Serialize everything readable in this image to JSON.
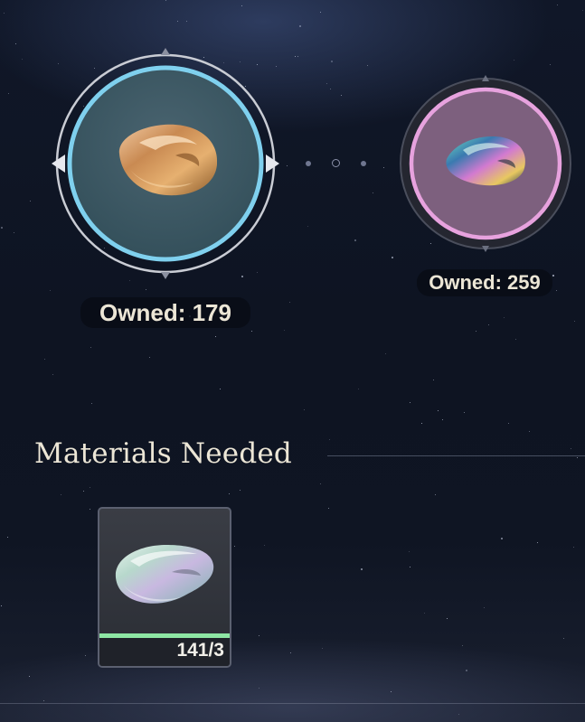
{
  "materials": [
    {
      "name_icon": "copper-ore-icon",
      "owned_label": "Owned: 179",
      "ring_color": "#7fd0ee",
      "selected": true
    },
    {
      "name_icon": "iridescent-ore-icon",
      "owned_label": "Owned: 259",
      "ring_color": "#e7a2de",
      "selected": false
    }
  ],
  "section": {
    "title": "Materials Needed"
  },
  "needed_item": {
    "icon": "prismatic-ore-icon",
    "count": "141/3",
    "progress": 1.0,
    "bar_color": "#8ee6a4"
  }
}
